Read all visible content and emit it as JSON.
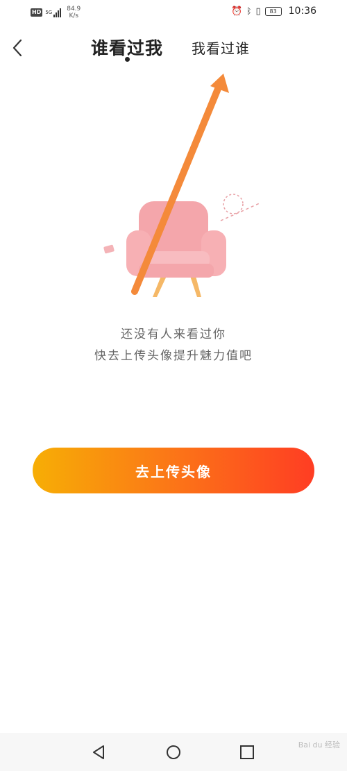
{
  "status_bar": {
    "hd": "HD",
    "network_gen": "5G",
    "speed_value": "84.9",
    "speed_unit": "K/s",
    "battery": "83",
    "time": "10:36"
  },
  "header": {
    "tab_active": "谁看过我",
    "tab_inactive": "我看过谁"
  },
  "empty_state": {
    "line1": "还没有人来看过你",
    "line2": "快去上传头像提升魅力值吧"
  },
  "upload_button": {
    "label": "去上传头像"
  },
  "colors": {
    "button_start": "#f7ae05",
    "button_end": "#ff3d23",
    "arrow": "#f48a3a",
    "sofa": "#f6a3a8"
  },
  "watermark": "Bai du 经验"
}
